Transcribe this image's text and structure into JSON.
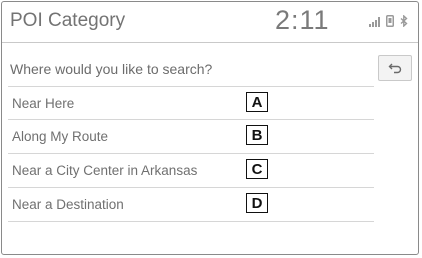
{
  "header": {
    "title": "POI Category",
    "clock": "2:11",
    "status_icons": [
      "signal-icon",
      "phone-icon",
      "bluetooth-icon"
    ]
  },
  "prompt": {
    "text": "Where would you like to search?",
    "back_icon": "back-arrow-icon"
  },
  "options": [
    {
      "label": "Near Here",
      "callout": "A"
    },
    {
      "label": "Along My Route",
      "callout": "B"
    },
    {
      "label": "Near a City Center in Arkansas",
      "callout": "C"
    },
    {
      "label": "Near a Destination",
      "callout": "D"
    }
  ]
}
